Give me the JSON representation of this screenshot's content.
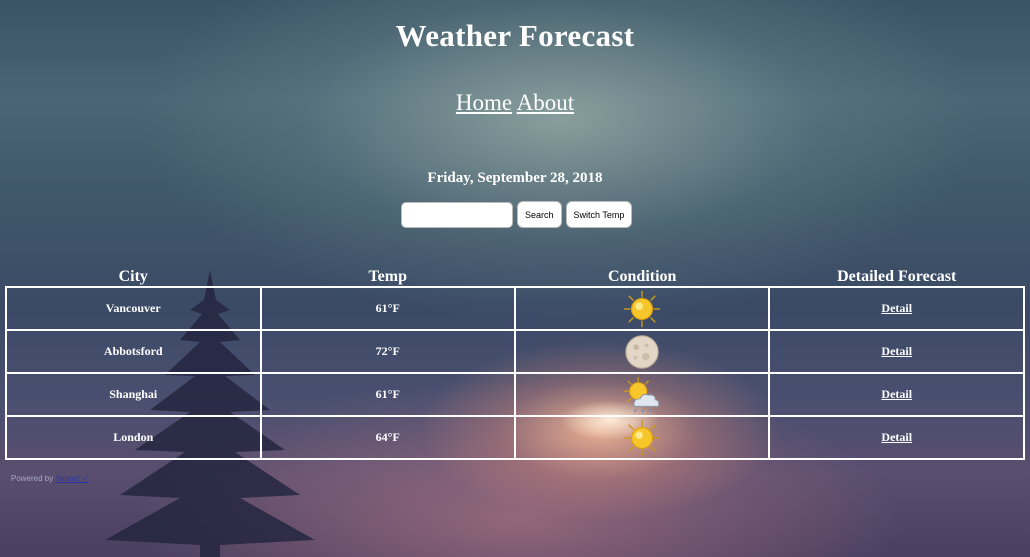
{
  "header": {
    "title": "Weather Forecast"
  },
  "nav": {
    "items": [
      {
        "label": "Home"
      },
      {
        "label": "About"
      }
    ]
  },
  "date": "Friday, September 28, 2018",
  "search": {
    "value": "",
    "placeholder": "",
    "search_label": "Search",
    "switch_label": "Switch Temp"
  },
  "table": {
    "headers": [
      "City",
      "Temp",
      "Condition",
      "Detailed Forecast"
    ],
    "rows": [
      {
        "city": "Vancouver",
        "temp": "61°F",
        "condition_icon": "sun-icon",
        "detail": "Detail"
      },
      {
        "city": "Abbotsford",
        "temp": "72°F",
        "condition_icon": "moon-icon",
        "detail": "Detail"
      },
      {
        "city": "Shanghai",
        "temp": "61°F",
        "condition_icon": "partly-cloudy-icon",
        "detail": "Detail"
      },
      {
        "city": "London",
        "temp": "64°F",
        "condition_icon": "sun-icon",
        "detail": "Detail"
      }
    ]
  },
  "footer": {
    "prefix": "Powered by",
    "link": "Yahoo! ✓"
  },
  "colors": {
    "text": "#ffffff",
    "border": "#ffffff",
    "footer_link": "#2b37a8"
  }
}
